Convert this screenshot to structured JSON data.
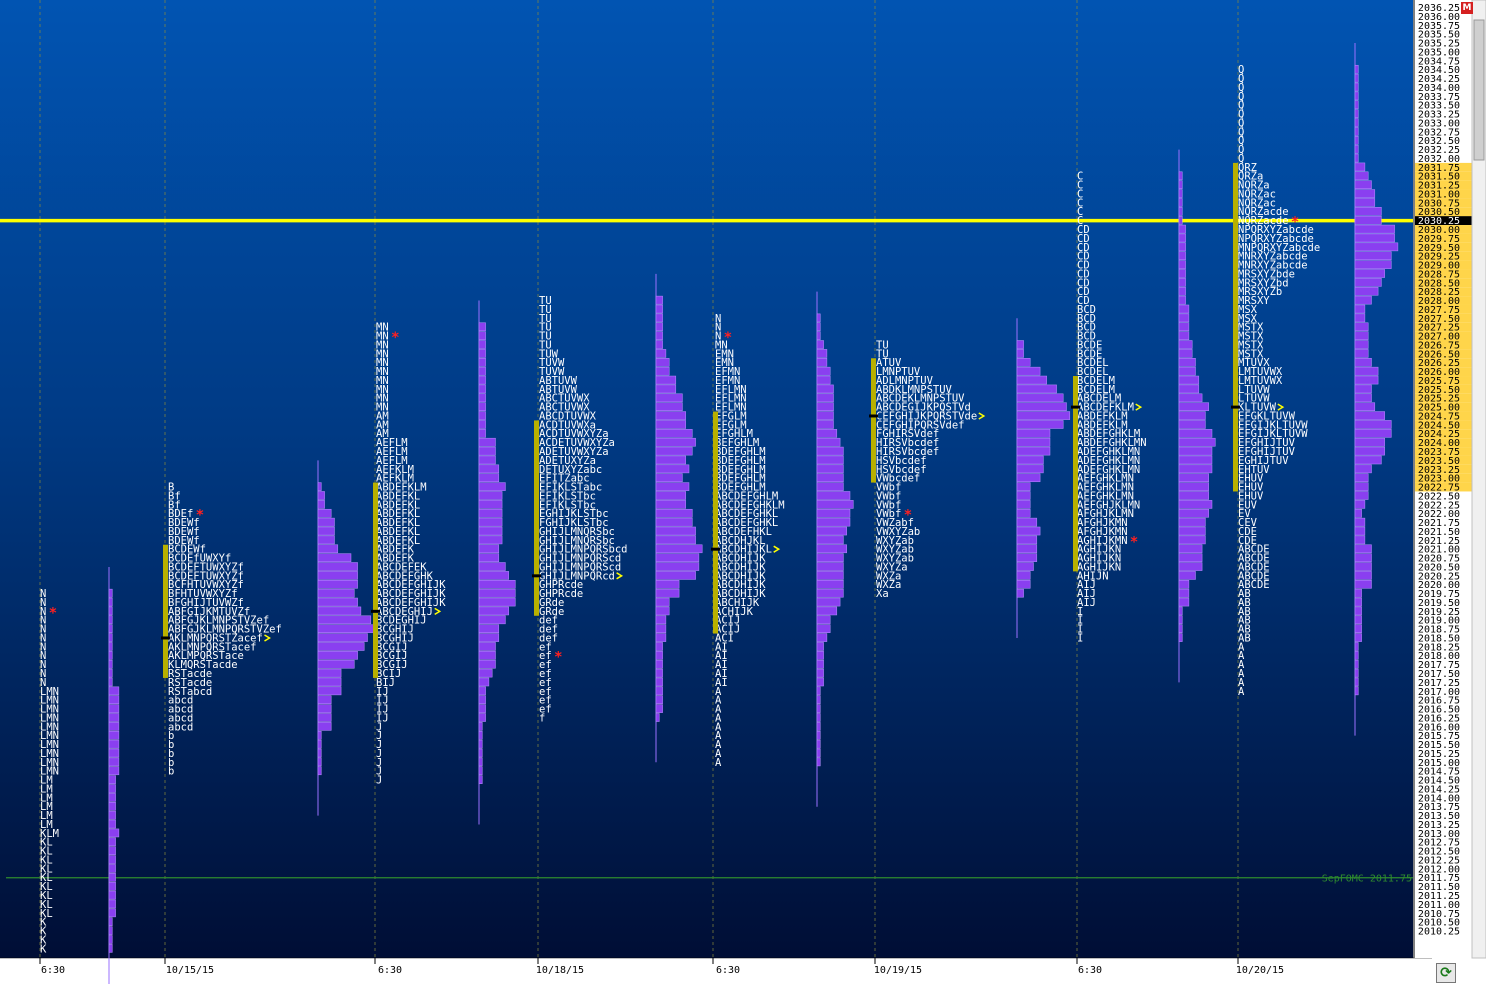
{
  "chart_data": {
    "type": "market-profile",
    "price_axis": {
      "top": 2036.25,
      "bottom": 2010.25,
      "step": 0.25,
      "side": "right"
    },
    "time_labels": [
      "6:30",
      "10/15/15",
      "6:30",
      "10/18/15",
      "6:30",
      "10/19/15",
      "6:30",
      "10/20/15"
    ],
    "reference_lines": [
      {
        "label": "",
        "price": 2030.25,
        "color": "#ffff00"
      },
      {
        "label": "SepFOMC 2011.75",
        "price": 2011.75,
        "color": "#2e8b2e"
      }
    ],
    "highlighted_prices": [
      2030.25
    ],
    "corner_badge": "M",
    "profiles": [
      {
        "top": 2019.75,
        "tpo": [
          "N",
          "N",
          "N",
          "N",
          "N",
          "N",
          "N",
          "N",
          "N",
          "N",
          "N",
          "LMN",
          "LMN",
          "LMN",
          "LMN",
          "LMN",
          "LMN",
          "LMN",
          "LMN",
          "LMN",
          "LMN",
          "LM",
          "LM",
          "LM",
          "LM",
          "LM",
          "LM",
          "KLM",
          "KL",
          "KL",
          "KL",
          "KL",
          "KL",
          "KL",
          "KL",
          "KL",
          "KL",
          "K",
          "K",
          "K",
          "K"
        ],
        "marks": [
          {
            "p": 2018.75,
            "m": "poc"
          }
        ],
        "stars": [
          2019.25
        ],
        "va": null,
        "tick": null,
        "hist": {
          "top": 2019.75,
          "widths": [
            0,
            0,
            0,
            0,
            0,
            0,
            0,
            2,
            2,
            4,
            4,
            6,
            8,
            10,
            16,
            20,
            18,
            14,
            16,
            12,
            10,
            8,
            8,
            8,
            8,
            8,
            8,
            8,
            8,
            6,
            6,
            6,
            6,
            6,
            4,
            4,
            4,
            4,
            4,
            3,
            2,
            2,
            2,
            2,
            2,
            2,
            2,
            2,
            2,
            2,
            2,
            2,
            2,
            2
          ]
        }
      },
      {
        "top": 2022.75,
        "tpo": [
          "B",
          "Bf",
          "Bf",
          "BDEf",
          "BDEWf",
          "BDEWf",
          "BDEWf",
          "BCDEWf",
          "BCDEfUWXYf",
          "BCDEFTUWXYZf",
          "BCDEFTUWXYZf",
          "BCFHTUVWXYZf",
          "BFHTUVWXYZf",
          "BFGHIJTUVWZf",
          "ABFGIJKMTUVZf",
          "ABFGJKLMNPSTVZef",
          "ABFGJKLMNPQRSTVZef",
          "AKLMNPQRSTZacef",
          "AKLMNPQRSTacef",
          "AKLMPQRSTace",
          "KLMQRSTacde",
          "RSTacde",
          "RSTacde",
          "RSTabcd",
          "abcd",
          "abcd",
          "abcd",
          "abcd",
          "b",
          "b",
          "b",
          "b",
          "b"
        ],
        "marks": [
          {
            "p": 2018.75,
            "m": "poc"
          }
        ],
        "stars": [
          2022.0
        ],
        "va": [
          2021.0,
          2017.5
        ],
        "tick": 2018.5,
        "hist": {
          "top": 2022.75,
          "widths": []
        }
      },
      {
        "top": 2027.25,
        "tpo": [
          "MN",
          "MN",
          "MN",
          "MN",
          "MN",
          "MN",
          "MN",
          "MN",
          "MN",
          "MN",
          "AM",
          "AM",
          "AM",
          "AEFLM",
          "AEFLM",
          "AEFLM",
          "AEFKLM",
          "AEFKLM",
          "ABDEFKLM",
          "ABDEFKL",
          "ABDEFKL",
          "ABDEFKL",
          "ABDEFKL",
          "ABDEFKL",
          "ABDEFKL",
          "ABDEFK",
          "ABDEFK",
          "ABCDEFEK",
          "ABCDEFGHK",
          "ABCDEFGHIJK",
          "ABCDEFGHIJK",
          "ABCDEFGHIJK",
          "ABCDEGHIJ",
          "BCDEGHIJ",
          "BCGHIJ",
          "BCGHIJ",
          "BCGIJ",
          "BCGIJ",
          "BCGIJ",
          "BCIJ",
          "BIJ",
          "IJ",
          "IJ",
          "IJ",
          "IJ",
          "J",
          "J",
          "J",
          "J",
          "J",
          "J",
          "J"
        ],
        "marks": [],
        "stars": [
          2027.0
        ],
        "va": [
          2022.75,
          2017.5
        ],
        "tick": 2019.25,
        "hist": {
          "top": 2023.0,
          "widths": []
        }
      },
      {
        "top": 2028.0,
        "tpo": [
          "TU",
          "TU",
          "TU",
          "TU",
          "TU",
          "TU",
          "TUW",
          "TUVW",
          "TUVW",
          "ABTUVW",
          "ABTUVW",
          "ABCTUVWX",
          "ABCTUVWX",
          "ABCDTUVWX",
          "ACDTUVWXa",
          "ACDTUVWXYZa",
          "ACDETUVWXYZa",
          "ADETUVWXYZa",
          "ADETUXYZa",
          "DETUXYZabc",
          "EFITZabc",
          "EFIKLSTabc",
          "EFIKLSTbc",
          "EFIKLSTbc",
          "EGHIJKLSTbc",
          "FGHIJKLSTbc",
          "GHIJLMNQRSbc",
          "GHIJLMNQRSbc",
          "GHIJLMNPQRSbcd",
          "GHIJLMNPQRScd",
          "GHIJLMNPQRScd",
          "GHIJLMNPQRcd",
          "GHPRcde",
          "GHPRcde",
          "GRde",
          "GRde",
          "def",
          "def",
          "def",
          "ef",
          "ef",
          "ef",
          "ef",
          "ef",
          "ef",
          "ef",
          "ef",
          "f"
        ],
        "marks": [],
        "stars": [
          2018.0
        ],
        "va": [
          2024.5,
          2019.25
        ],
        "tick": 2020.25,
        "hist": {
          "top": 2024.5,
          "widths": []
        }
      },
      {
        "top": 2027.5,
        "tpo": [
          "N",
          "N",
          "N",
          "MN",
          "EMN",
          "EMN",
          "EFMN",
          "EFMN",
          "EFLMN",
          "EFLMN",
          "EFLMN",
          "EFGLM",
          "EFGLM",
          "EFGHLM",
          "BEFGHLM",
          "BDEFGHLM",
          "BDEFGHLM",
          "BDEFGHLM",
          "BDEFGHLM",
          "BDEFGHLM",
          "ABCDEFGHLM",
          "ABCDEFGHKLM",
          "ABCDEFGHKL",
          "ABCDEFGHKL",
          "ABCDEFHKL",
          "ABCDHJKL",
          "ABCDHIJKL",
          "ABCDHIJK",
          "ABCDHIJK",
          "ABCDHIJK",
          "ABCDHIJK",
          "ABCDHIJK",
          "ABCHIJK",
          "ACHIJK",
          "ACIJ",
          "ACIJ",
          "ACI",
          "AI",
          "AI",
          "AI",
          "AI",
          "AI",
          "A",
          "A",
          "A",
          "A",
          "A",
          "A",
          "A",
          "A",
          "A"
        ],
        "marks": [],
        "stars": [
          2027.0
        ],
        "va": [
          2024.75,
          2018.75
        ],
        "tick": 2021.0,
        "hist": {
          "top": 2028.75,
          "widths": []
        }
      },
      {
        "top": 2026.75,
        "tpo": [
          "TU",
          "TU",
          "ATUV",
          "LMNPTUV",
          "ADLMNPTUV",
          "ABDKLMNPSTUV",
          "ABCDEKLMNPSTUV",
          "ABCDEGIJKPQSTVd",
          "CEFGHIJKPQRSTVde",
          "CEFGHIPQRSVdef",
          "FGHIRSVdef",
          "HIRSVbcdef",
          "HIRSVbcdef",
          "HSVbcdef",
          "HSVbcdef",
          "VWbcdef",
          "VWbf",
          "VWbf",
          "VWbf",
          "VWbf",
          "VWZabf",
          "VWXYZab",
          "WXYZab",
          "WXYZab",
          "WXYZab",
          "WXYZa",
          "WXZa",
          "WXZa",
          "Xa"
        ],
        "marks": [],
        "stars": [
          2022.0
        ],
        "va": [
          2026.25,
          2023.0
        ],
        "tick": 2024.75,
        "hist": {
          "top": 2027.5,
          "widths": []
        }
      },
      {
        "top": 2031.5,
        "tpo": [
          "C",
          "C",
          "C",
          "C",
          "C",
          "C",
          "CD",
          "CD",
          "CD",
          "CD",
          "CD",
          "CD",
          "CD",
          "CD",
          "CD",
          "BCD",
          "BCD",
          "BCD",
          "BCD",
          "BCDE",
          "BCDE",
          "BCDEL",
          "BCDEL",
          "BCDELM",
          "BCDELM",
          "ABCDELM",
          "ABCDEFKLM",
          "ABDEFKLM",
          "ABDEFKLM",
          "ABDEFGHKLM",
          "ABDEFGHKLMN",
          "ADEFGHKLMN",
          "ADEFGHKLMN",
          "ADEFGHKLMN",
          "AEFGHKLMN",
          "AEFGHKLMN",
          "AEFGHKLMN",
          "AEFGHJKLMN",
          "AFGHJKLMN",
          "AFGHJKMN",
          "AFGHJKMN",
          "AGHIJKMN",
          "AGHIJKN",
          "AGHIJKN",
          "AGHIJKN",
          "AHIJN",
          "AIJ",
          "AIJ",
          "AIJ",
          "I",
          "I",
          "I",
          "I"
        ],
        "marks": [
          {
            "p": 2021.75,
            "m": "poc"
          }
        ],
        "stars": [
          2021.25
        ],
        "va": [
          2025.75,
          2020.5
        ],
        "tick": 2025.0,
        "hist": {
          "top": 2026.0,
          "widths": []
        }
      },
      {
        "top": 2034.5,
        "tpo": [
          "Q",
          "Q",
          "Q",
          "Q",
          "Q",
          "Q",
          "Q",
          "Q",
          "Q",
          "Q",
          "Q",
          "QRZ",
          "QRZa",
          "NQRZa",
          "NQRZac",
          "NQRZac",
          "NQRZacde",
          "NQRZacde",
          "NPQRXYZabcde",
          "NPQRXYZabcde",
          "MNPQRXYZabcde",
          "MNRXYZabcde",
          "MNRXYZabcde",
          "MRSXYZbde",
          "MRSXYZbd",
          "MRSXYZb",
          "MRSXY",
          "MSX",
          "MSX",
          "MSTX",
          "MSTX",
          "MSTX",
          "MSTX",
          "MTUVX",
          "LMTUVWX",
          "LMTUVWX",
          "LTUVW",
          "LTUVW",
          "KLTUVW",
          "EFGKLTUVW",
          "EFGIJKLTUVW",
          "EFGIJKLTUVW",
          "EFGHIJTUV",
          "EFGHIJTUV",
          "EGHIJTUV",
          "EHTUV",
          "EHUV",
          "EHUV",
          "EHUV",
          "EUV",
          "EV",
          "CEV",
          "CDE",
          "CDE",
          "ABCDE",
          "ABCDE",
          "ABCDE",
          "ABCDE",
          "ABCDE",
          "AB",
          "AB",
          "AB",
          "AB",
          "AB",
          "AB",
          "A",
          "A",
          "A",
          "A",
          "A",
          "A"
        ],
        "marks": [
          {
            "p": 2021.75,
            "m": "poc"
          }
        ],
        "stars": [
          2030.25
        ],
        "va": [
          2031.75,
          2022.75
        ],
        "tick": 2025.0,
        "hist": {
          "top": 2034.25,
          "widths": []
        }
      }
    ]
  }
}
